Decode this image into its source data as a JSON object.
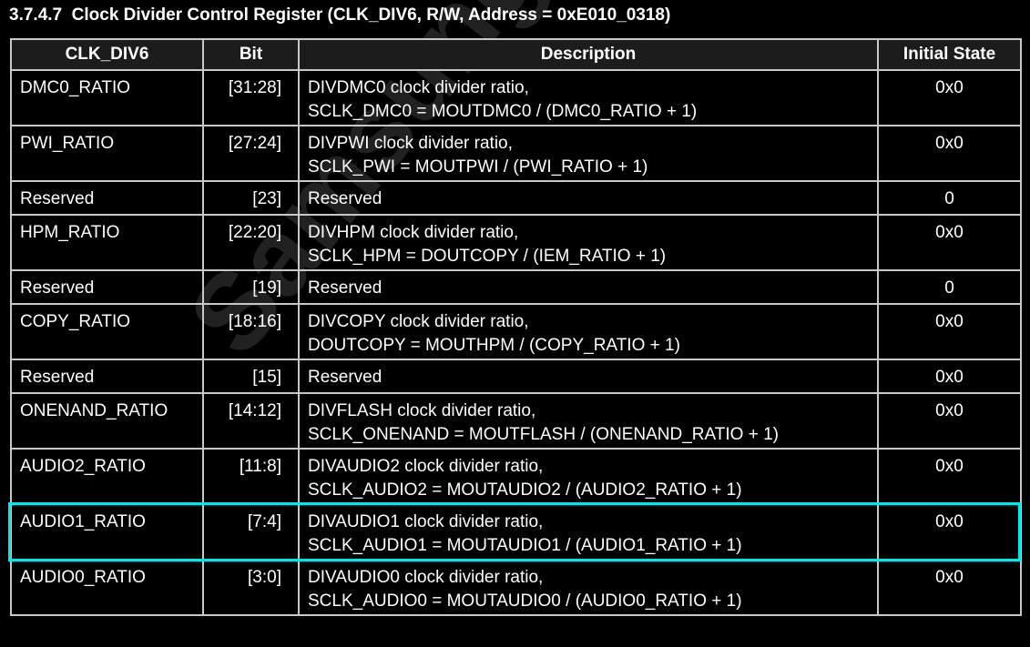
{
  "title": "3.7.4.7  Clock Divider Control Register (CLK_DIV6, R/W, Address = 0xE010_0318)",
  "watermark": "Samsung Confidential",
  "highlight_color": "#00e8e8",
  "headers": [
    "CLK_DIV6",
    "Bit",
    "Description",
    "Initial State"
  ],
  "rows": [
    {
      "name": "DMC0_RATIO",
      "bit": "[31:28]",
      "desc1": "DIVDMC0 clock divider ratio,",
      "desc2": "SCLK_DMC0 = MOUTDMC0 / (DMC0_RATIO + 1)",
      "init": "0x0"
    },
    {
      "name": "PWI_RATIO",
      "bit": "[27:24]",
      "desc1": "DIVPWI clock divider ratio,",
      "desc2": "SCLK_PWI = MOUTPWI / (PWI_RATIO + 1)",
      "init": "0x0"
    },
    {
      "name": "Reserved",
      "bit": "[23]",
      "desc1": "Reserved",
      "desc2": "",
      "init": "0"
    },
    {
      "name": "HPM_RATIO",
      "bit": "[22:20]",
      "desc1": "DIVHPM clock divider ratio,",
      "desc2": "SCLK_HPM = DOUTCOPY / (IEM_RATIO + 1)",
      "init": "0x0"
    },
    {
      "name": "Reserved",
      "bit": "[19]",
      "desc1": "Reserved",
      "desc2": "",
      "init": "0"
    },
    {
      "name": "COPY_RATIO",
      "bit": "[18:16]",
      "desc1": "DIVCOPY clock divider ratio,",
      "desc2": "DOUTCOPY = MOUTHPM / (COPY_RATIO + 1)",
      "init": "0x0"
    },
    {
      "name": "Reserved",
      "bit": "[15]",
      "desc1": "Reserved",
      "desc2": "",
      "init": "0x0"
    },
    {
      "name": "ONENAND_RATIO",
      "bit": "[14:12]",
      "desc1": "DIVFLASH clock divider ratio,",
      "desc2": "SCLK_ONENAND = MOUTFLASH / (ONENAND_RATIO + 1)",
      "init": "0x0"
    },
    {
      "name": "AUDIO2_RATIO",
      "bit": "[11:8]",
      "desc1": "DIVAUDIO2 clock divider ratio,",
      "desc2": "SCLK_AUDIO2 = MOUTAUDIO2 / (AUDIO2_RATIO + 1)",
      "init": "0x0"
    },
    {
      "name": "AUDIO1_RATIO",
      "bit": "[7:4]",
      "desc1": "DIVAUDIO1 clock divider ratio,",
      "desc2": "SCLK_AUDIO1 = MOUTAUDIO1 / (AUDIO1_RATIO + 1)",
      "init": "0x0",
      "highlighted": true
    },
    {
      "name": "AUDIO0_RATIO",
      "bit": "[3:0]",
      "desc1": "DIVAUDIO0 clock divider ratio,",
      "desc2": "SCLK_AUDIO0 = MOUTAUDIO0 / (AUDIO0_RATIO + 1)",
      "init": "0x0"
    }
  ]
}
